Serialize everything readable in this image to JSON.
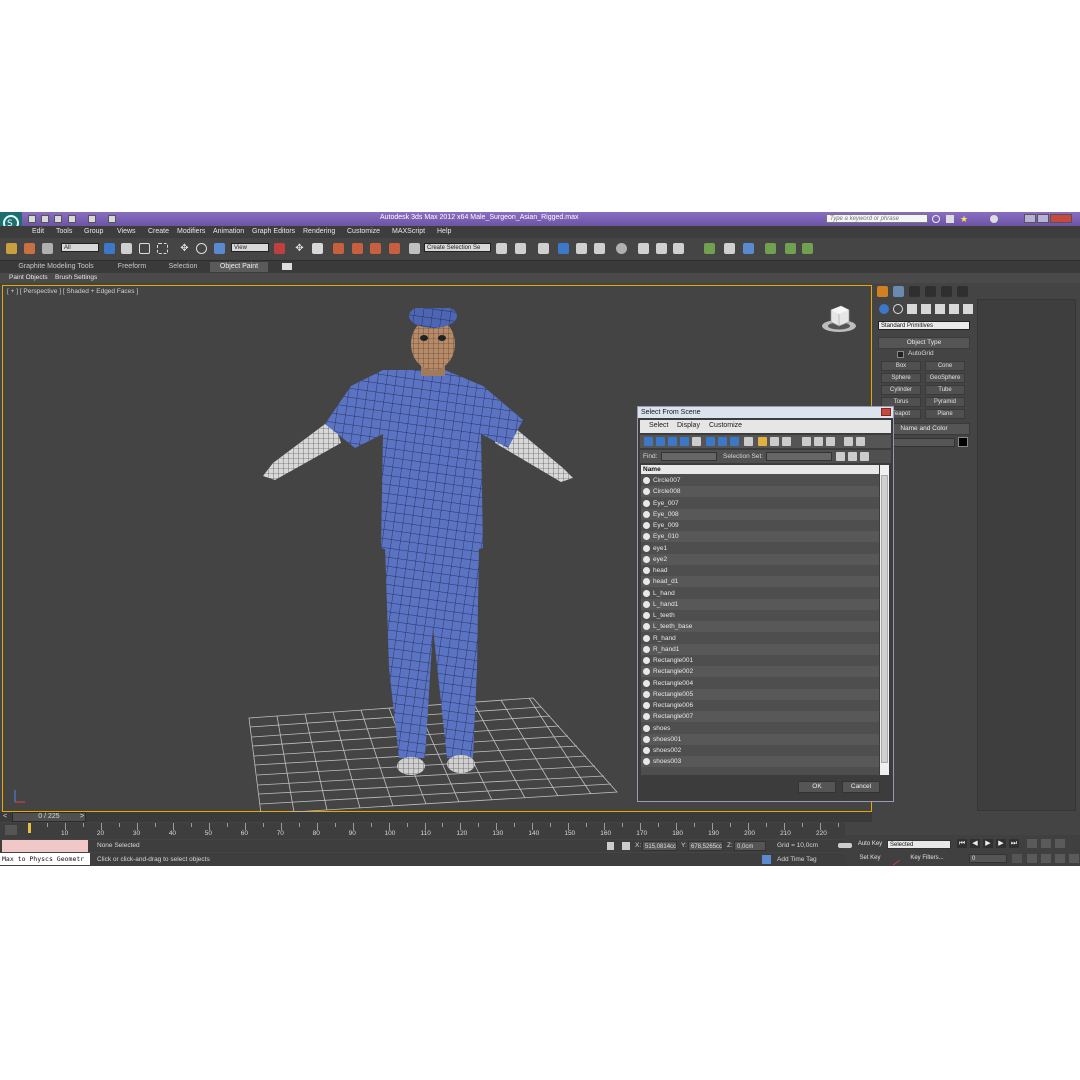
{
  "app": {
    "title": "Autodesk 3ds Max  2012 x64      Male_Surgeon_Asian_Rigged.max",
    "search_placeholder": "Type a keyword or phrase"
  },
  "menu": [
    "Edit",
    "Tools",
    "Group",
    "Views",
    "Create",
    "Modifiers",
    "Animation",
    "Graph Editors",
    "Rendering",
    "Customize",
    "MAXScript",
    "Help"
  ],
  "toolbar": {
    "filter_value": "All",
    "ref_coord_value": "View",
    "selection_set_value": "Create Selection Se"
  },
  "ribbon": {
    "tabs": [
      "Graphite Modeling Tools",
      "Freeform",
      "Selection",
      "Object Paint"
    ],
    "subtabs": [
      "Paint Objects",
      "Brush Settings"
    ]
  },
  "viewport": {
    "label": "[ + ] [ Perspective ] [ Shaded + Edged Faces ]"
  },
  "command_panel": {
    "category": "Standard Primitives",
    "object_type_header": "Object Type",
    "autogrid": "AutoGrid",
    "primitives": [
      "Box",
      "Cone",
      "Sphere",
      "GeoSphere",
      "Cylinder",
      "Tube",
      "Torus",
      "Pyramid",
      "Teapot",
      "Plane"
    ],
    "name_color_header": "Name and Color"
  },
  "dialog": {
    "title": "Select From Scene",
    "menu": [
      "Select",
      "Display",
      "Customize"
    ],
    "find_label": "Find:",
    "selection_set_label": "Selection Set:",
    "column_name": "Name",
    "items": [
      "Circle007",
      "Circle008",
      "Eye_007",
      "Eye_008",
      "Eye_009",
      "Eye_010",
      "eye1",
      "eye2",
      "head",
      "head_d1",
      "L_hand",
      "L_hand1",
      "L_teeth",
      "L_teeth_base",
      "R_hand",
      "R_hand1",
      "Rectangle001",
      "Rectangle002",
      "Rectangle004",
      "Rectangle005",
      "Rectangle006",
      "Rectangle007",
      "shoes",
      "shoes001",
      "shoes002",
      "shoes003"
    ],
    "ok": "OK",
    "cancel": "Cancel"
  },
  "timeline": {
    "frame_counter": "0 / 225",
    "ticks": [
      "10",
      "20",
      "30",
      "40",
      "50",
      "60",
      "70",
      "80",
      "90",
      "100",
      "110",
      "120",
      "130",
      "140",
      "150",
      "160",
      "170",
      "180",
      "190",
      "200",
      "210",
      "220"
    ]
  },
  "status": {
    "listener": "Max to Physcs Geometr",
    "selection": "None Selected",
    "prompt": "Click or click-and-drag to select objects",
    "x_label": "X:",
    "x_value": "515,0814cc",
    "y_label": "Y:",
    "y_value": "678,5265cc",
    "z_label": "Z:",
    "z_value": "0,0cm",
    "grid": "Grid = 10,0cm",
    "add_time_tag": "Add Time Tag",
    "auto_key": "Auto Key",
    "set_key": "Set Key",
    "selected_dropdown": "Selected",
    "key_filters": "Key Filters...",
    "frame_value": "0"
  }
}
